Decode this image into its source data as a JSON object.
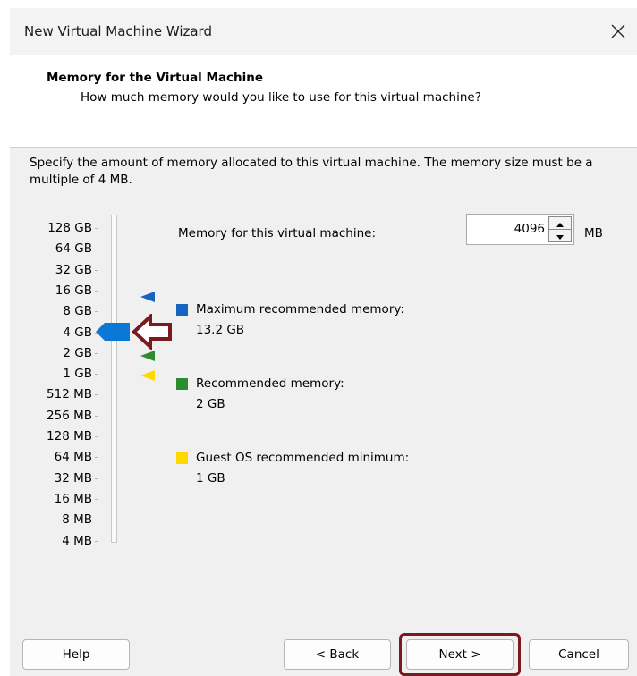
{
  "window": {
    "title": "New Virtual Machine Wizard",
    "close_icon": "close-icon"
  },
  "header": {
    "title": "Memory for the Virtual Machine",
    "subtitle": "How much memory would you like to use for this virtual machine?"
  },
  "description": "Specify the amount of memory allocated to this virtual machine. The memory size must be a multiple of 4 MB.",
  "slider": {
    "labels": [
      "128 GB",
      "64 GB",
      "32 GB",
      "16 GB",
      "8 GB",
      "4 GB",
      "2 GB",
      "1 GB",
      "512 MB",
      "256 MB",
      "128 MB",
      "64 MB",
      "32 MB",
      "16 MB",
      "8 MB",
      "4 MB"
    ],
    "selected": "4 GB"
  },
  "memory": {
    "label": "Memory for this virtual machine:",
    "value": "4096",
    "unit": "MB"
  },
  "legend": {
    "max_title": "Maximum recommended memory:",
    "max_value": "13.2 GB",
    "max_color": "#1565c0",
    "rec_title": "Recommended memory:",
    "rec_value": "2 GB",
    "rec_color": "#2e8b2e",
    "min_title": "Guest OS recommended minimum:",
    "min_value": "1 GB",
    "min_color": "#ffd800"
  },
  "buttons": {
    "help": "Help",
    "back": "< Back",
    "next": "Next >",
    "cancel": "Cancel"
  },
  "colors": {
    "thumb": "#0a78d7",
    "highlight": "#7b1920"
  }
}
